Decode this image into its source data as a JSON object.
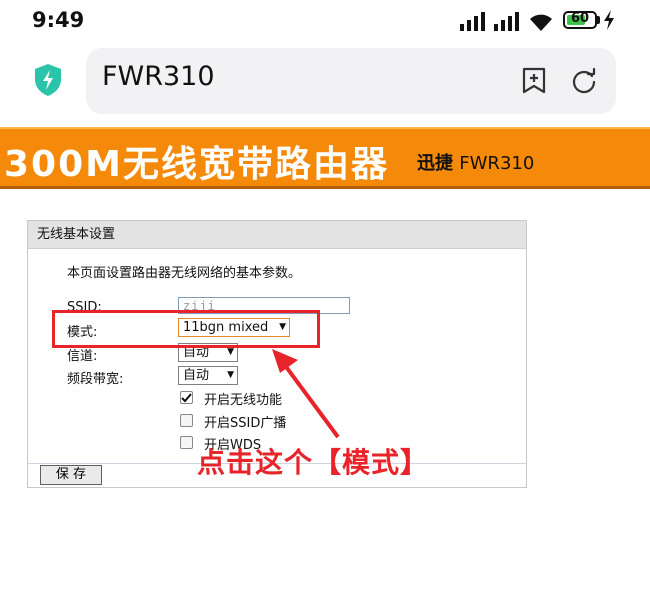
{
  "status_bar": {
    "time": "9:49",
    "battery": "60",
    "battery_level": 0.6
  },
  "address_bar": {
    "title": "FWR310"
  },
  "banner": {
    "title": "300M无线宽带路由器",
    "brand": "迅捷",
    "model": "FWR310"
  },
  "panel": {
    "heading": "无线基本设置",
    "description": "本页面设置路由器无线网络的基本参数。",
    "ssid_label": "SSID:",
    "ssid_value": "ziji",
    "mode_label": "模式:",
    "mode_value": "11bgn mixed",
    "channel_label": "信道:",
    "channel_value": "自动",
    "bandwidth_label": "频段带宽:",
    "bandwidth_value": "自动",
    "checkboxes": [
      {
        "label": "开启无线功能",
        "checked": true
      },
      {
        "label": "开启SSID广播",
        "checked": false
      },
      {
        "label": "开启WDS",
        "checked": false
      }
    ],
    "save_label": "保 存"
  },
  "annotation": {
    "text": "点击这个【模式】",
    "color": "#e8232a"
  },
  "colors": {
    "banner": "#f58a0a",
    "accent": "#3fc24a"
  }
}
